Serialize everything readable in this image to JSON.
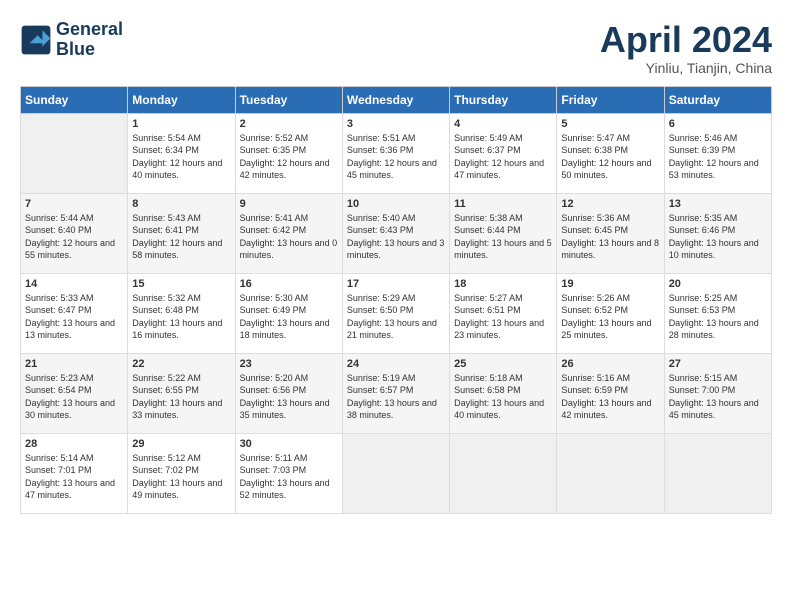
{
  "logo": {
    "text_line1": "General",
    "text_line2": "Blue"
  },
  "title": "April 2024",
  "subtitle": "Yinliu, Tianjin, China",
  "weekdays": [
    "Sunday",
    "Monday",
    "Tuesday",
    "Wednesday",
    "Thursday",
    "Friday",
    "Saturday"
  ],
  "weeks": [
    [
      {
        "day": "",
        "empty": true
      },
      {
        "day": "1",
        "sunrise": "5:54 AM",
        "sunset": "6:34 PM",
        "daylight": "12 hours and 40 minutes."
      },
      {
        "day": "2",
        "sunrise": "5:52 AM",
        "sunset": "6:35 PM",
        "daylight": "12 hours and 42 minutes."
      },
      {
        "day": "3",
        "sunrise": "5:51 AM",
        "sunset": "6:36 PM",
        "daylight": "12 hours and 45 minutes."
      },
      {
        "day": "4",
        "sunrise": "5:49 AM",
        "sunset": "6:37 PM",
        "daylight": "12 hours and 47 minutes."
      },
      {
        "day": "5",
        "sunrise": "5:47 AM",
        "sunset": "6:38 PM",
        "daylight": "12 hours and 50 minutes."
      },
      {
        "day": "6",
        "sunrise": "5:46 AM",
        "sunset": "6:39 PM",
        "daylight": "12 hours and 53 minutes."
      }
    ],
    [
      {
        "day": "7",
        "sunrise": "5:44 AM",
        "sunset": "6:40 PM",
        "daylight": "12 hours and 55 minutes."
      },
      {
        "day": "8",
        "sunrise": "5:43 AM",
        "sunset": "6:41 PM",
        "daylight": "12 hours and 58 minutes."
      },
      {
        "day": "9",
        "sunrise": "5:41 AM",
        "sunset": "6:42 PM",
        "daylight": "13 hours and 0 minutes."
      },
      {
        "day": "10",
        "sunrise": "5:40 AM",
        "sunset": "6:43 PM",
        "daylight": "13 hours and 3 minutes."
      },
      {
        "day": "11",
        "sunrise": "5:38 AM",
        "sunset": "6:44 PM",
        "daylight": "13 hours and 5 minutes."
      },
      {
        "day": "12",
        "sunrise": "5:36 AM",
        "sunset": "6:45 PM",
        "daylight": "13 hours and 8 minutes."
      },
      {
        "day": "13",
        "sunrise": "5:35 AM",
        "sunset": "6:46 PM",
        "daylight": "13 hours and 10 minutes."
      }
    ],
    [
      {
        "day": "14",
        "sunrise": "5:33 AM",
        "sunset": "6:47 PM",
        "daylight": "13 hours and 13 minutes."
      },
      {
        "day": "15",
        "sunrise": "5:32 AM",
        "sunset": "6:48 PM",
        "daylight": "13 hours and 16 minutes."
      },
      {
        "day": "16",
        "sunrise": "5:30 AM",
        "sunset": "6:49 PM",
        "daylight": "13 hours and 18 minutes."
      },
      {
        "day": "17",
        "sunrise": "5:29 AM",
        "sunset": "6:50 PM",
        "daylight": "13 hours and 21 minutes."
      },
      {
        "day": "18",
        "sunrise": "5:27 AM",
        "sunset": "6:51 PM",
        "daylight": "13 hours and 23 minutes."
      },
      {
        "day": "19",
        "sunrise": "5:26 AM",
        "sunset": "6:52 PM",
        "daylight": "13 hours and 25 minutes."
      },
      {
        "day": "20",
        "sunrise": "5:25 AM",
        "sunset": "6:53 PM",
        "daylight": "13 hours and 28 minutes."
      }
    ],
    [
      {
        "day": "21",
        "sunrise": "5:23 AM",
        "sunset": "6:54 PM",
        "daylight": "13 hours and 30 minutes."
      },
      {
        "day": "22",
        "sunrise": "5:22 AM",
        "sunset": "6:55 PM",
        "daylight": "13 hours and 33 minutes."
      },
      {
        "day": "23",
        "sunrise": "5:20 AM",
        "sunset": "6:56 PM",
        "daylight": "13 hours and 35 minutes."
      },
      {
        "day": "24",
        "sunrise": "5:19 AM",
        "sunset": "6:57 PM",
        "daylight": "13 hours and 38 minutes."
      },
      {
        "day": "25",
        "sunrise": "5:18 AM",
        "sunset": "6:58 PM",
        "daylight": "13 hours and 40 minutes."
      },
      {
        "day": "26",
        "sunrise": "5:16 AM",
        "sunset": "6:59 PM",
        "daylight": "13 hours and 42 minutes."
      },
      {
        "day": "27",
        "sunrise": "5:15 AM",
        "sunset": "7:00 PM",
        "daylight": "13 hours and 45 minutes."
      }
    ],
    [
      {
        "day": "28",
        "sunrise": "5:14 AM",
        "sunset": "7:01 PM",
        "daylight": "13 hours and 47 minutes."
      },
      {
        "day": "29",
        "sunrise": "5:12 AM",
        "sunset": "7:02 PM",
        "daylight": "13 hours and 49 minutes."
      },
      {
        "day": "30",
        "sunrise": "5:11 AM",
        "sunset": "7:03 PM",
        "daylight": "13 hours and 52 minutes."
      },
      {
        "day": "",
        "empty": true
      },
      {
        "day": "",
        "empty": true
      },
      {
        "day": "",
        "empty": true
      },
      {
        "day": "",
        "empty": true
      }
    ]
  ],
  "labels": {
    "sunrise": "Sunrise:",
    "sunset": "Sunset:",
    "daylight": "Daylight:"
  }
}
